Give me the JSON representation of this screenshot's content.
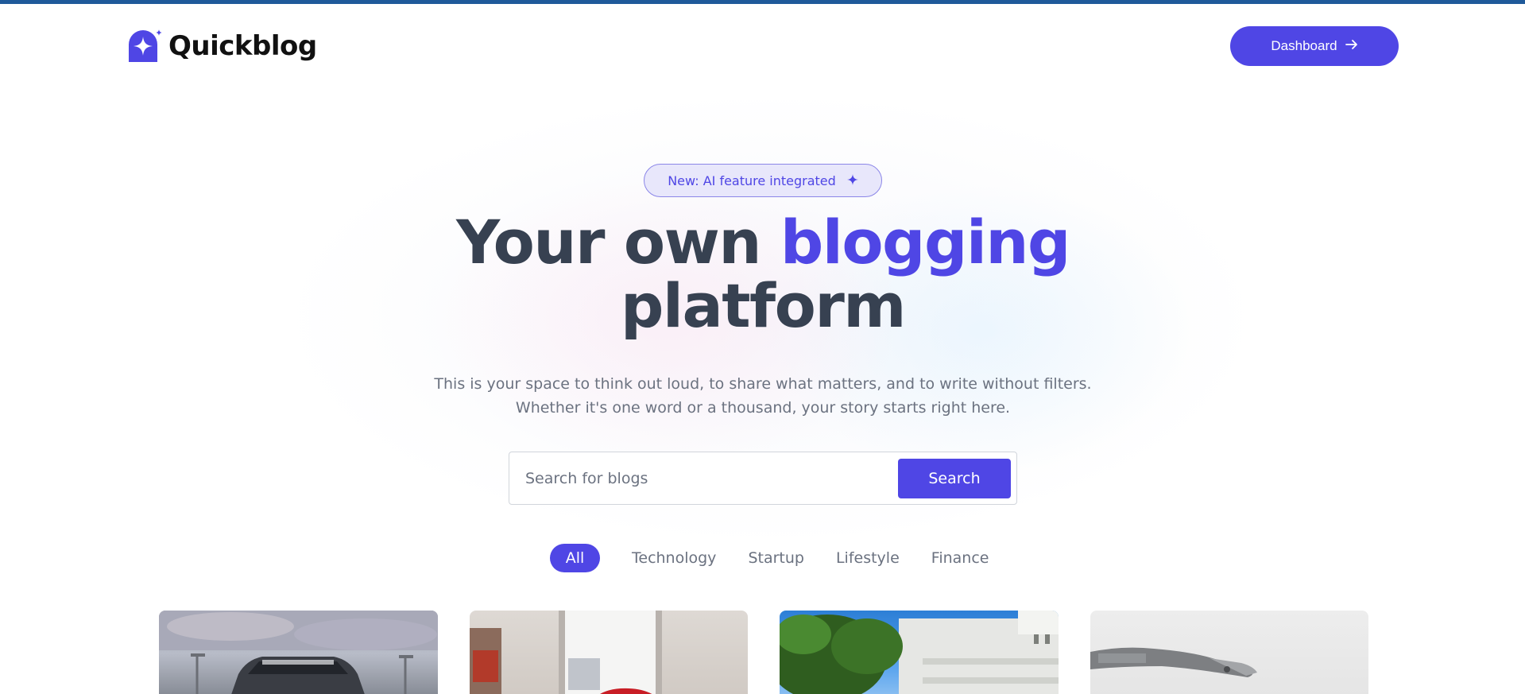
{
  "app": {
    "name": "Quickblog"
  },
  "header": {
    "dashboard_label": "Dashboard"
  },
  "hero": {
    "badge_text": "New: AI feature integrated",
    "title_part1": "Your own",
    "title_accent": "blogging",
    "title_part2": "platform",
    "subtitle": "This is your space to think out loud, to share what matters, and to write without filters. Whether it's one word or a thousand, your story starts right here."
  },
  "search": {
    "placeholder": "Search for blogs",
    "value": "",
    "button_label": "Search"
  },
  "filters": [
    {
      "label": "All",
      "active": true
    },
    {
      "label": "Technology",
      "active": false
    },
    {
      "label": "Startup",
      "active": false
    },
    {
      "label": "Lifestyle",
      "active": false
    },
    {
      "label": "Finance",
      "active": false
    }
  ],
  "cards": [
    {
      "image": "sports-car-front"
    },
    {
      "image": "red-car-interior"
    },
    {
      "image": "white-building-trees"
    },
    {
      "image": "robot-hand"
    }
  ],
  "colors": {
    "accent": "#4f46e5",
    "top_bar": "#1f5a9a",
    "title_text": "#374151",
    "muted_text": "#6b7280"
  },
  "icons": {
    "logo": "sparkle-logo-icon",
    "dashboard_arrow": "arrow-right-icon",
    "badge": "sparkle-icon"
  }
}
